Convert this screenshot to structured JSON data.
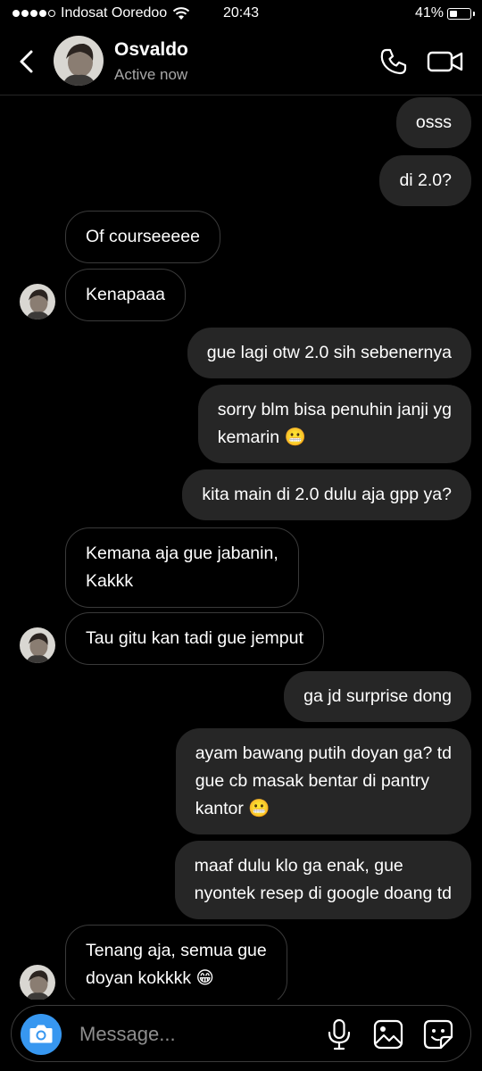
{
  "status_bar": {
    "carrier": "Indosat Ooredoo",
    "time": "20:43",
    "battery": "41%",
    "battery_level": 0.41,
    "signal_bars": 4
  },
  "header": {
    "contact_name": "Osvaldo",
    "contact_status": "Active now"
  },
  "composer": {
    "placeholder": "Message..."
  },
  "colors": {
    "sent_bubble": "#262626",
    "accent": "#3797f0",
    "background": "#000000"
  },
  "messages": [
    {
      "direction": "sent",
      "text": "osss"
    },
    {
      "direction": "sent",
      "text": "di 2.0?"
    },
    {
      "direction": "received",
      "text": "Of courseeeee"
    },
    {
      "direction": "received",
      "text": "Kenapaaa"
    },
    {
      "direction": "sent",
      "text": "gue lagi otw 2.0 sih sebenernya"
    },
    {
      "direction": "sent",
      "text": "sorry blm bisa penuhin janji yg\nkemarin 😬"
    },
    {
      "direction": "sent",
      "text": "kita main di 2.0 dulu aja gpp ya?"
    },
    {
      "direction": "received",
      "text": "Kemana aja gue jabanin,\nKakkk"
    },
    {
      "direction": "received",
      "text": "Tau gitu kan tadi gue jemput"
    },
    {
      "direction": "sent",
      "text": "ga jd surprise dong"
    },
    {
      "direction": "sent",
      "text": "ayam bawang putih doyan ga? td\ngue cb masak bentar di pantry\nkantor 😬"
    },
    {
      "direction": "sent",
      "text": "maaf dulu klo ga enak, gue\nnyontek resep di google doang td"
    },
    {
      "direction": "received",
      "text": "Tenang aja, semua gue\ndoyan kokkkk 😁"
    }
  ]
}
